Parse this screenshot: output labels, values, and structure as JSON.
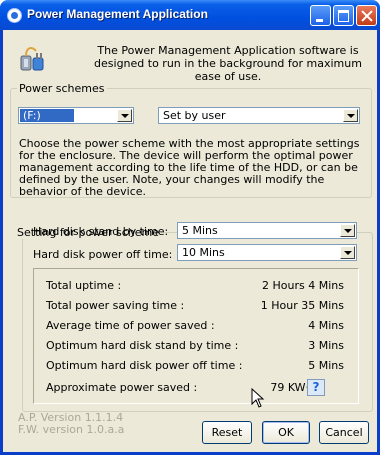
{
  "window": {
    "title": "Power Management Application"
  },
  "info": {
    "text": "The Power Management Application software is designed to run in the background for maximum ease of use."
  },
  "schemes": {
    "legend": "Power schemes",
    "drive": "(F:)",
    "scheme": "Set by user",
    "description": "Choose the power scheme with the most appropriate settings for the enclosure. The device will perform the optimal power management according to the life time of the HDD, or can be defined by the user. Note, your changes will modify the behavior of the device."
  },
  "settings": {
    "legend": "Setting for power scheme",
    "standby_label": "Hard disk stand by time:",
    "standby_value": "5 Mins",
    "poweroff_label": "Hard disk power off time:",
    "poweroff_value": "10 Mins"
  },
  "stats": [
    {
      "label": "Total uptime :",
      "value": "2 Hours  4 Mins"
    },
    {
      "label": "Total power saving time :",
      "value": "1 Hour 35 Mins"
    },
    {
      "label": "Average time of power saved :",
      "value": "4 Mins"
    },
    {
      "label": "Optimum hard disk stand by time :",
      "value": "3 Mins"
    },
    {
      "label": "Optimum hard disk power off time :",
      "value": "5 Mins"
    },
    {
      "label": "Approximate power saved :",
      "value": "79 KW·S"
    }
  ],
  "help": {
    "glyph": "?"
  },
  "versions": {
    "ap": "A.P. Version 1.1.1.4",
    "fw": "F.W. version 1.0.a.a"
  },
  "buttons": {
    "reset": "Reset",
    "ok": "OK",
    "cancel": "Cancel"
  },
  "colors": {
    "titlebar": "#0050e0",
    "face": "#ece9d8",
    "selection": "#316ac5"
  }
}
